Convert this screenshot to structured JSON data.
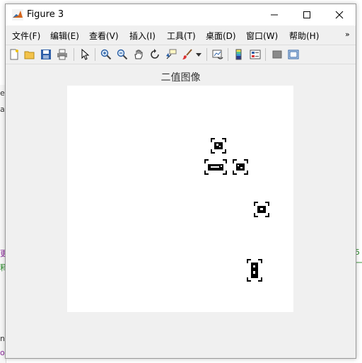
{
  "window": {
    "title": "Figure 3"
  },
  "menu": [
    "文件(F)",
    "编辑(E)",
    "查看(V)",
    "插入(I)",
    "工具(T)",
    "桌面(D)",
    "窗口(W)",
    "帮助(H)"
  ],
  "menu_overflow": "»",
  "toolbar_icons": [
    "new-figure-icon",
    "open-file-icon",
    "save-icon",
    "print-icon",
    "select-pointer-icon",
    "zoom-in-icon",
    "zoom-out-icon",
    "pan-hand-icon",
    "rotate-3d-icon",
    "data-cursor-icon",
    "brush-icon",
    "brush-dropdown-icon",
    "link-plot-icon",
    "colorbar-icon",
    "legend-icon",
    "hide-plot-tools-icon",
    "show-plot-tools-icon"
  ],
  "axes": {
    "title": "二值图像"
  },
  "background": {
    "fragments": [
      "er",
      "al",
      "更",
      "释",
      "nf",
      "og"
    ],
    "right_fragment": "5一"
  }
}
